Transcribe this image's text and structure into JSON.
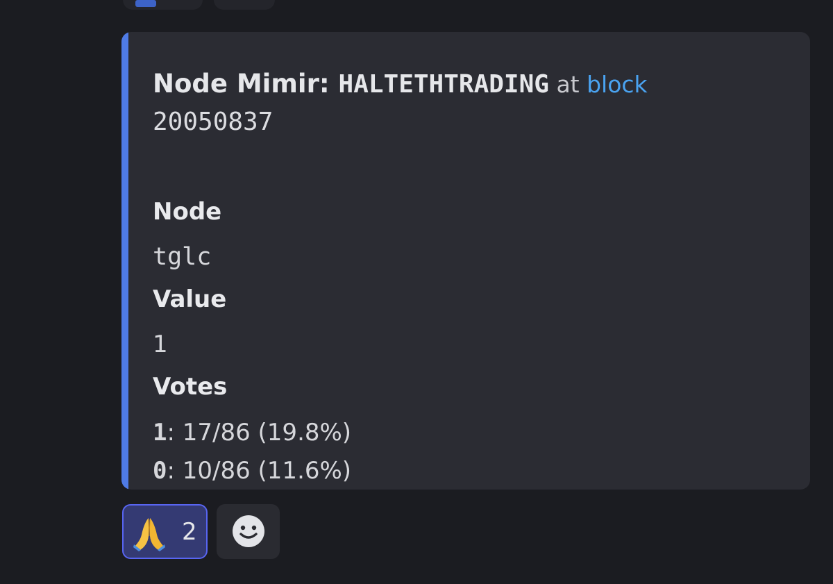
{
  "embed": {
    "title_prefix": "Node Mimir: ",
    "title_code": "HALTETHTRADING",
    "title_at": " at ",
    "title_link": "block",
    "block_number": "20050837",
    "fields": {
      "node_label": "Node",
      "node_value": "tglc",
      "value_label": "Value",
      "value_value": "1",
      "votes_label": "Votes"
    },
    "votes": [
      {
        "key": "1",
        "text": ": 17/86 (19.8%)"
      },
      {
        "key": "0",
        "text": ": 10/86 (11.6%)"
      }
    ],
    "accent_color": "#4f7be6",
    "link_color": "#4aa3f0"
  },
  "reactions": [
    {
      "emoji_icon": "folded-hands-icon",
      "count": "2",
      "selected": true
    },
    {
      "emoji_icon": "add-reaction-smile-icon"
    }
  ]
}
